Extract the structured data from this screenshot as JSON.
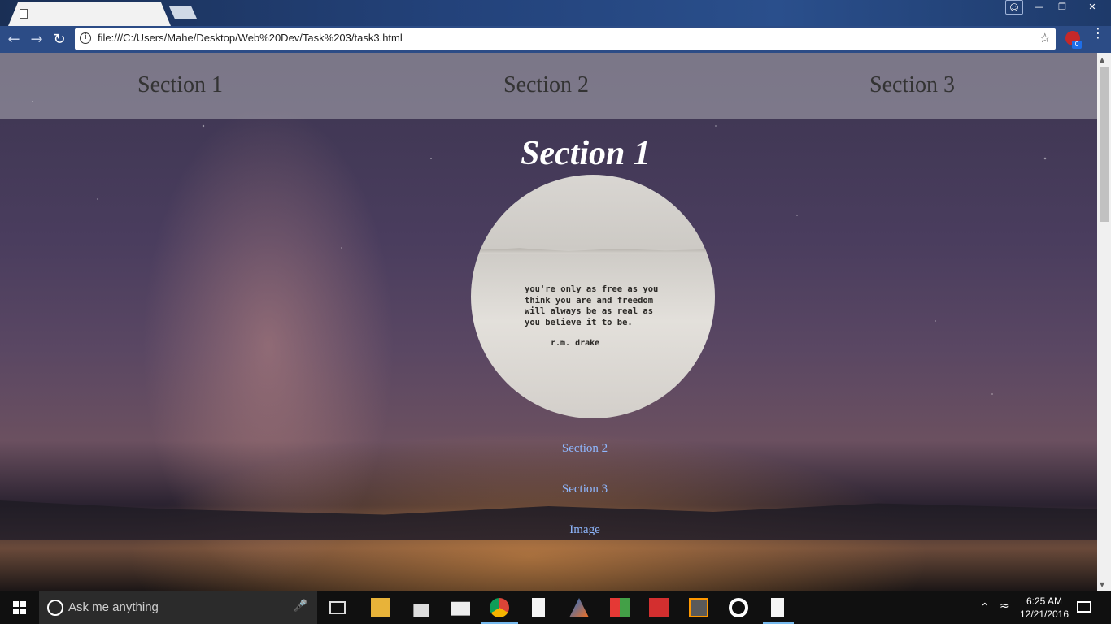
{
  "browser": {
    "address_url": "file:///C:/Users/Mahe/Desktop/Web%20Dev/Task%203/task3.html",
    "extension_badge": "0"
  },
  "page": {
    "nav": [
      "Section 1",
      "Section 2",
      "Section 3"
    ],
    "heading": "Section 1",
    "quote_lines": "you're only as free as you\nthink you are and freedom\nwill always be as real as\nyou believe it to be.",
    "quote_author": "r.m. drake",
    "links": [
      "Section 2",
      "Section 3",
      "Image"
    ]
  },
  "taskbar": {
    "search_placeholder": "Ask me anything",
    "time": "6:25 AM",
    "date": "12/21/2016"
  }
}
